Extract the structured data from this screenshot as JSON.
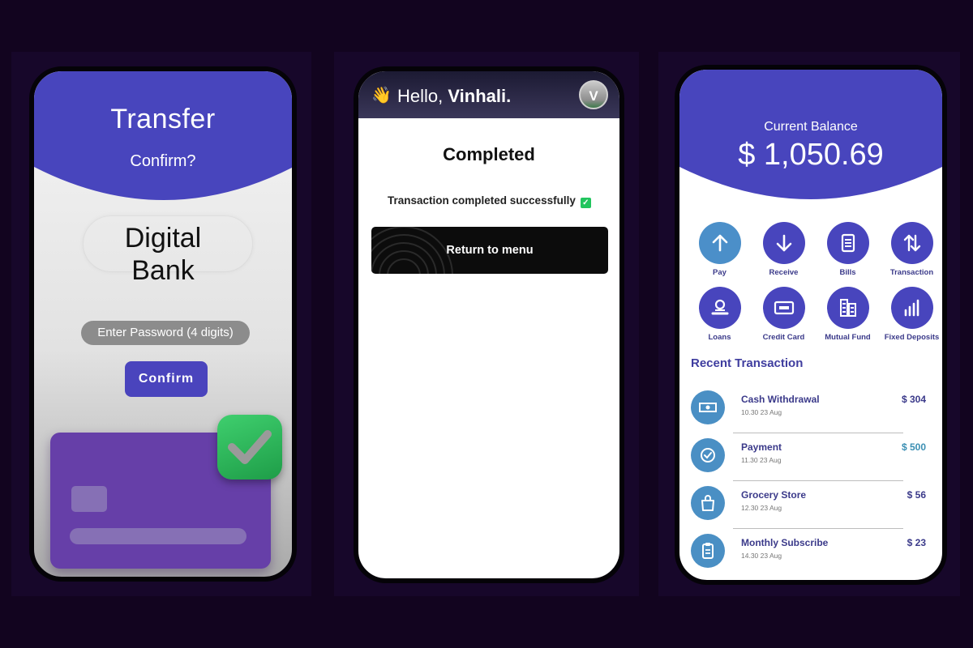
{
  "transfer_screen": {
    "title": "Transfer",
    "subtitle": "Confirm?",
    "bank_line1": "Digital",
    "bank_line2": "Bank",
    "password_placeholder": "Enter Password (4 digits)",
    "confirm_button": "Confirm"
  },
  "completed_screen": {
    "greeting_emoji": "👋",
    "greeting_prefix": "Hello,",
    "user_name": "Vinhali.",
    "avatar_initial": "V",
    "title": "Completed",
    "message": "Transaction completed successfully",
    "check_mark": "✓",
    "return_button": "Return to menu"
  },
  "home_screen": {
    "balance_label": "Current Balance",
    "balance_amount": "$ 1,050.69",
    "quick_actions": [
      {
        "label": "Pay",
        "icon": "arrow-up-icon"
      },
      {
        "label": "Receive",
        "icon": "arrow-down-icon"
      },
      {
        "label": "Bills",
        "icon": "bill-icon"
      },
      {
        "label": "Transaction",
        "icon": "swap-icon"
      },
      {
        "label": "Loans",
        "icon": "loan-icon"
      },
      {
        "label": "Credit Card",
        "icon": "credit-card-icon"
      },
      {
        "label": "Mutual Fund",
        "icon": "mutual-fund-icon"
      },
      {
        "label": "Fixed Deposits",
        "icon": "bar-chart-icon"
      }
    ],
    "recent_title": "Recent Transaction",
    "transactions": [
      {
        "name": "Cash Withdrawal",
        "time": "10.30 23 Aug",
        "amount": "$ 304",
        "icon": "cash-icon"
      },
      {
        "name": "Payment",
        "time": "11.30 23 Aug",
        "amount": "$ 500",
        "icon": "check-circle-icon"
      },
      {
        "name": "Grocery Store",
        "time": "12.30 23  Aug",
        "amount": "$ 56",
        "icon": "shopping-bag-icon"
      },
      {
        "name": "Monthly Subscribe",
        "time": "14.30 23  Aug",
        "amount": "$ 23",
        "icon": "clipboard-icon"
      }
    ]
  },
  "colors": {
    "background": "#12041f",
    "primary": "#4845bd",
    "accent_blue": "#4a8fc4",
    "card_purple": "#663fa8",
    "success_green": "#22c55e"
  }
}
